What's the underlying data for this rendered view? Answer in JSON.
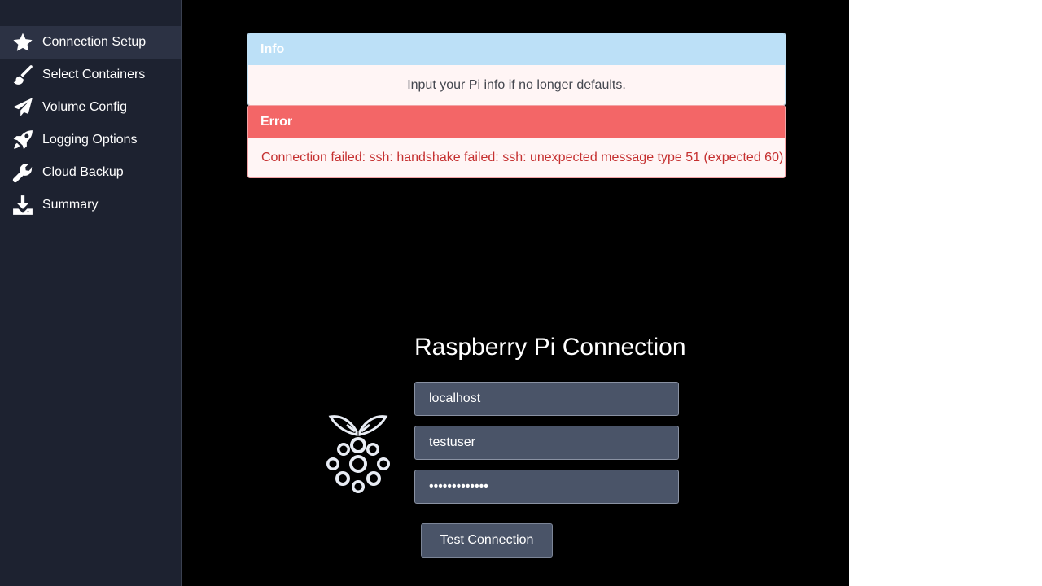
{
  "sidebar": {
    "items": [
      {
        "label": "Connection Setup",
        "icon": "star-icon",
        "active": true
      },
      {
        "label": "Select Containers",
        "icon": "paintbrush-icon",
        "active": false
      },
      {
        "label": "Volume Config",
        "icon": "paper-plane-icon",
        "active": false
      },
      {
        "label": "Logging Options",
        "icon": "rocket-icon",
        "active": false
      },
      {
        "label": "Cloud Backup",
        "icon": "wrench-icon",
        "active": false
      },
      {
        "label": "Summary",
        "icon": "download-icon",
        "active": false
      }
    ]
  },
  "alerts": {
    "info": {
      "title": "Info",
      "message": "Input your Pi info if no longer defaults."
    },
    "error": {
      "title": "Error",
      "message": "Connection failed: ssh: handshake failed: ssh: unexpected message type 51 (expected 60)"
    }
  },
  "connection": {
    "title": "Raspberry Pi Connection",
    "host_value": "localhost",
    "user_value": "testuser",
    "password_value": "•••••••••••••",
    "test_button_label": "Test Connection"
  },
  "colors": {
    "sidebar_bg": "#1d2230",
    "main_bg": "#000000",
    "info_header": "#bce0f7",
    "error_header": "#f36667",
    "error_text": "#c53030",
    "input_bg": "#4a5468"
  }
}
